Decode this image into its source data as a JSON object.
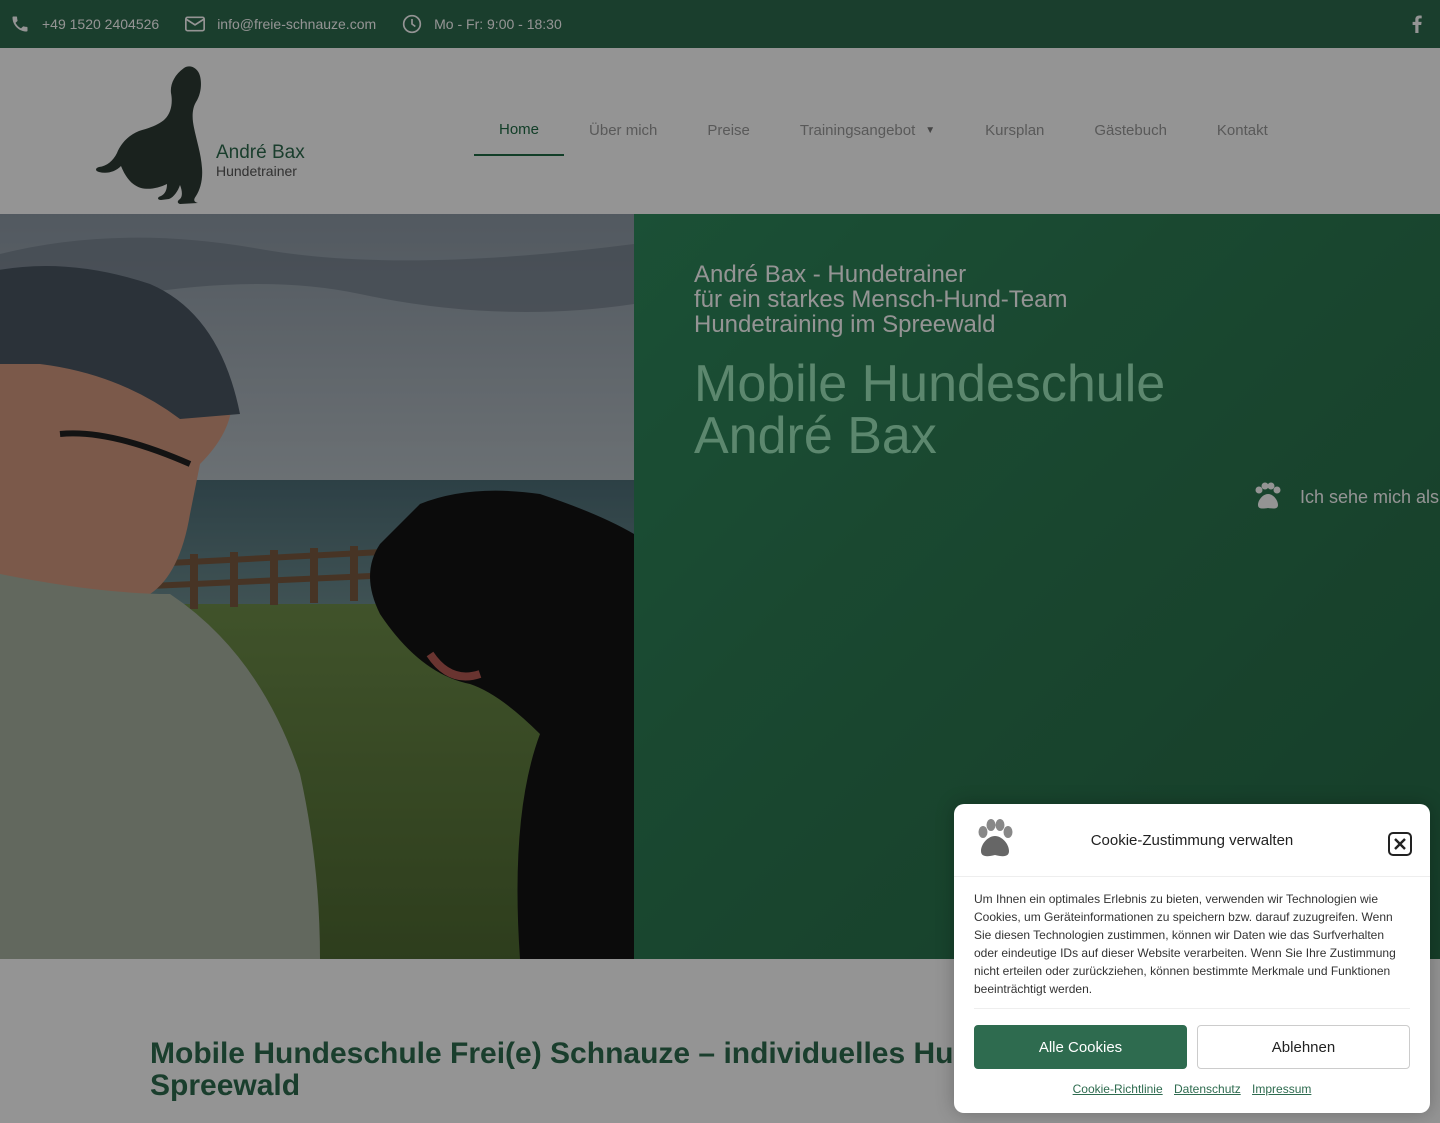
{
  "topbar": {
    "phone": "+49 1520 2404526",
    "email": "info@freie-schnauze.com",
    "hours": "Mo - Fr: 9:00 - 18:30"
  },
  "logo": {
    "name": "André Bax",
    "tagline": "Hundetrainer"
  },
  "nav": {
    "items": [
      {
        "label": "Home"
      },
      {
        "label": "Über mich"
      },
      {
        "label": "Preise"
      },
      {
        "label": "Trainingsangebot"
      },
      {
        "label": "Kursplan"
      },
      {
        "label": "Gästebuch"
      },
      {
        "label": "Kontakt"
      }
    ]
  },
  "hero": {
    "sub1": "André Bax - Hundetrainer",
    "sub2": "für ein starkes Mensch-Hund-Team",
    "sub3": "Hundetraining im Spreewald",
    "title1": "Mobile Hundeschule",
    "title2": "André Bax",
    "ticker": "Ich sehe mich als"
  },
  "section": {
    "title": "Mobile Hundeschule Frei(e) Schnauze – individuelles Hundetraining im Spreewald"
  },
  "cookie": {
    "title": "Cookie-Zustimmung verwalten",
    "text": "Um Ihnen ein optimales Erlebnis zu bieten, verwenden wir Technologien wie Cookies, um Geräteinformationen zu speichern bzw. darauf zuzugreifen. Wenn Sie diesen Technologien zustimmen, können wir Daten wie das Surfverhalten oder eindeutige IDs auf dieser Website verarbeiten. Wenn Sie Ihre Zustimmung nicht erteilen oder zurückziehen, können bestimmte Merkmale und Funktionen beeinträchtigt werden.",
    "accept_label": "Alle Cookies",
    "deny_label": "Ablehnen",
    "link1": "Cookie-Richtlinie",
    "link2": "Datenschutz",
    "link3": "Impressum"
  },
  "colors": {
    "brand": "#2e6b4f",
    "accent_text": "#9fe8bd"
  }
}
